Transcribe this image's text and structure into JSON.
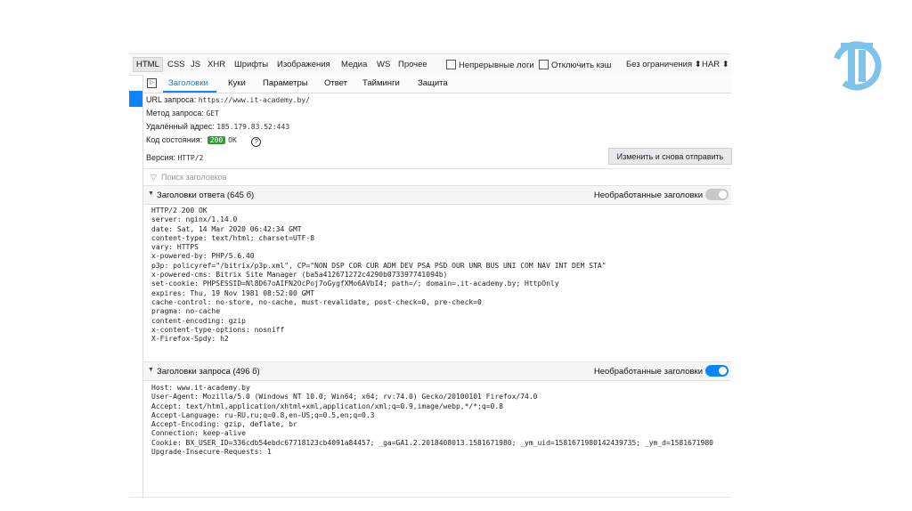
{
  "filter_tabs": [
    "HTML",
    "CSS",
    "JS",
    "XHR",
    "Шрифты",
    "Изображения",
    "Медиа",
    "WS",
    "Прочее"
  ],
  "active_filter_tab": "HTML",
  "checkboxes": {
    "persist_logs": "Непрерывные логи",
    "disable_cache": "Отключить кэш"
  },
  "throttle": {
    "label": "Без ограничения ⬍"
  },
  "har": {
    "label": "HAR ⬍"
  },
  "panel_tabs": [
    "Заголовки",
    "Куки",
    "Параметры",
    "Ответ",
    "Тайминги",
    "Защита"
  ],
  "active_panel_tab": "Заголовки",
  "summary": {
    "url_label": "URL запроса:",
    "url_value": "https://www.it-academy.by/",
    "method_label": "Метод запроса:",
    "method_value": "GET",
    "remote_label": "Удалённый адрес:",
    "remote_value": "185.179.83.52:443",
    "status_label": "Код состояния:",
    "status_code": "200",
    "status_text": "OK",
    "help": "?",
    "version_label": "Версия:",
    "version_value": "HTTP/2"
  },
  "resend_button": "Изменить и снова отправить",
  "filter_placeholder": "Поиск заголовков",
  "colors": {
    "accent": "#0a84ff",
    "status_ok": "#2f9e31"
  },
  "response_headers": {
    "title": "Заголовки ответа (645 б)",
    "raw_label": "Необработанные заголовки",
    "raw_enabled": false,
    "text": "HTTP/2 200 OK\nserver: nginx/1.14.0\ndate: Sat, 14 Mar 2020 06:42:34 GMT\ncontent-type: text/html; charset=UTF-8\nvary: HTTPS\nx-powered-by: PHP/5.6.40\np3p: policyref=\"/bitrix/p3p.xml\", CP=\"NON DSP COR CUR ADM DEV PSA PSD OUR UNR BUS UNI COM NAV INT DEM STA\"\nx-powered-cms: Bitrix Site Manager (ba5a412671272c4290b073397741094b)\nset-cookie: PHPSESSID=Nl8D67oAIFN2OcPoj7oGygfXMo6AVbI4; path=/; domain=.it-academy.by; HttpOnly\nexpires: Thu, 19 Nov 1981 08:52:00 GMT\ncache-control: no-store, no-cache, must-revalidate, post-check=0, pre-check=0\npragma: no-cache\ncontent-encoding: gzip\nx-content-type-options: nosniff\nX-Firefox-Spdy: h2"
  },
  "request_headers": {
    "title": "Заголовки запроса (496 б)",
    "raw_label": "Необработанные заголовки",
    "raw_enabled": true,
    "text": "Host: www.it-academy.by\nUser-Agent: Mozilla/5.0 (Windows NT 10.0; Win64; x64; rv:74.0) Gecko/20100101 Firefox/74.0\nAccept: text/html,application/xhtml+xml,application/xml;q=0.9,image/webp,*/*;q=0.8\nAccept-Language: ru-RU,ru;q=0.8,en-US;q=0.5,en;q=0.3\nAccept-Encoding: gzip, deflate, br\nConnection: keep-alive\nCookie: BX_USER_ID=336cdb54ebdc67718123cb4091a84457; _ga=GA1.2.2018408013.1581671980; _ym_uid=1581671980142439735; _ym_d=1581671980\nUpgrade-Insecure-Requests: 1"
  }
}
